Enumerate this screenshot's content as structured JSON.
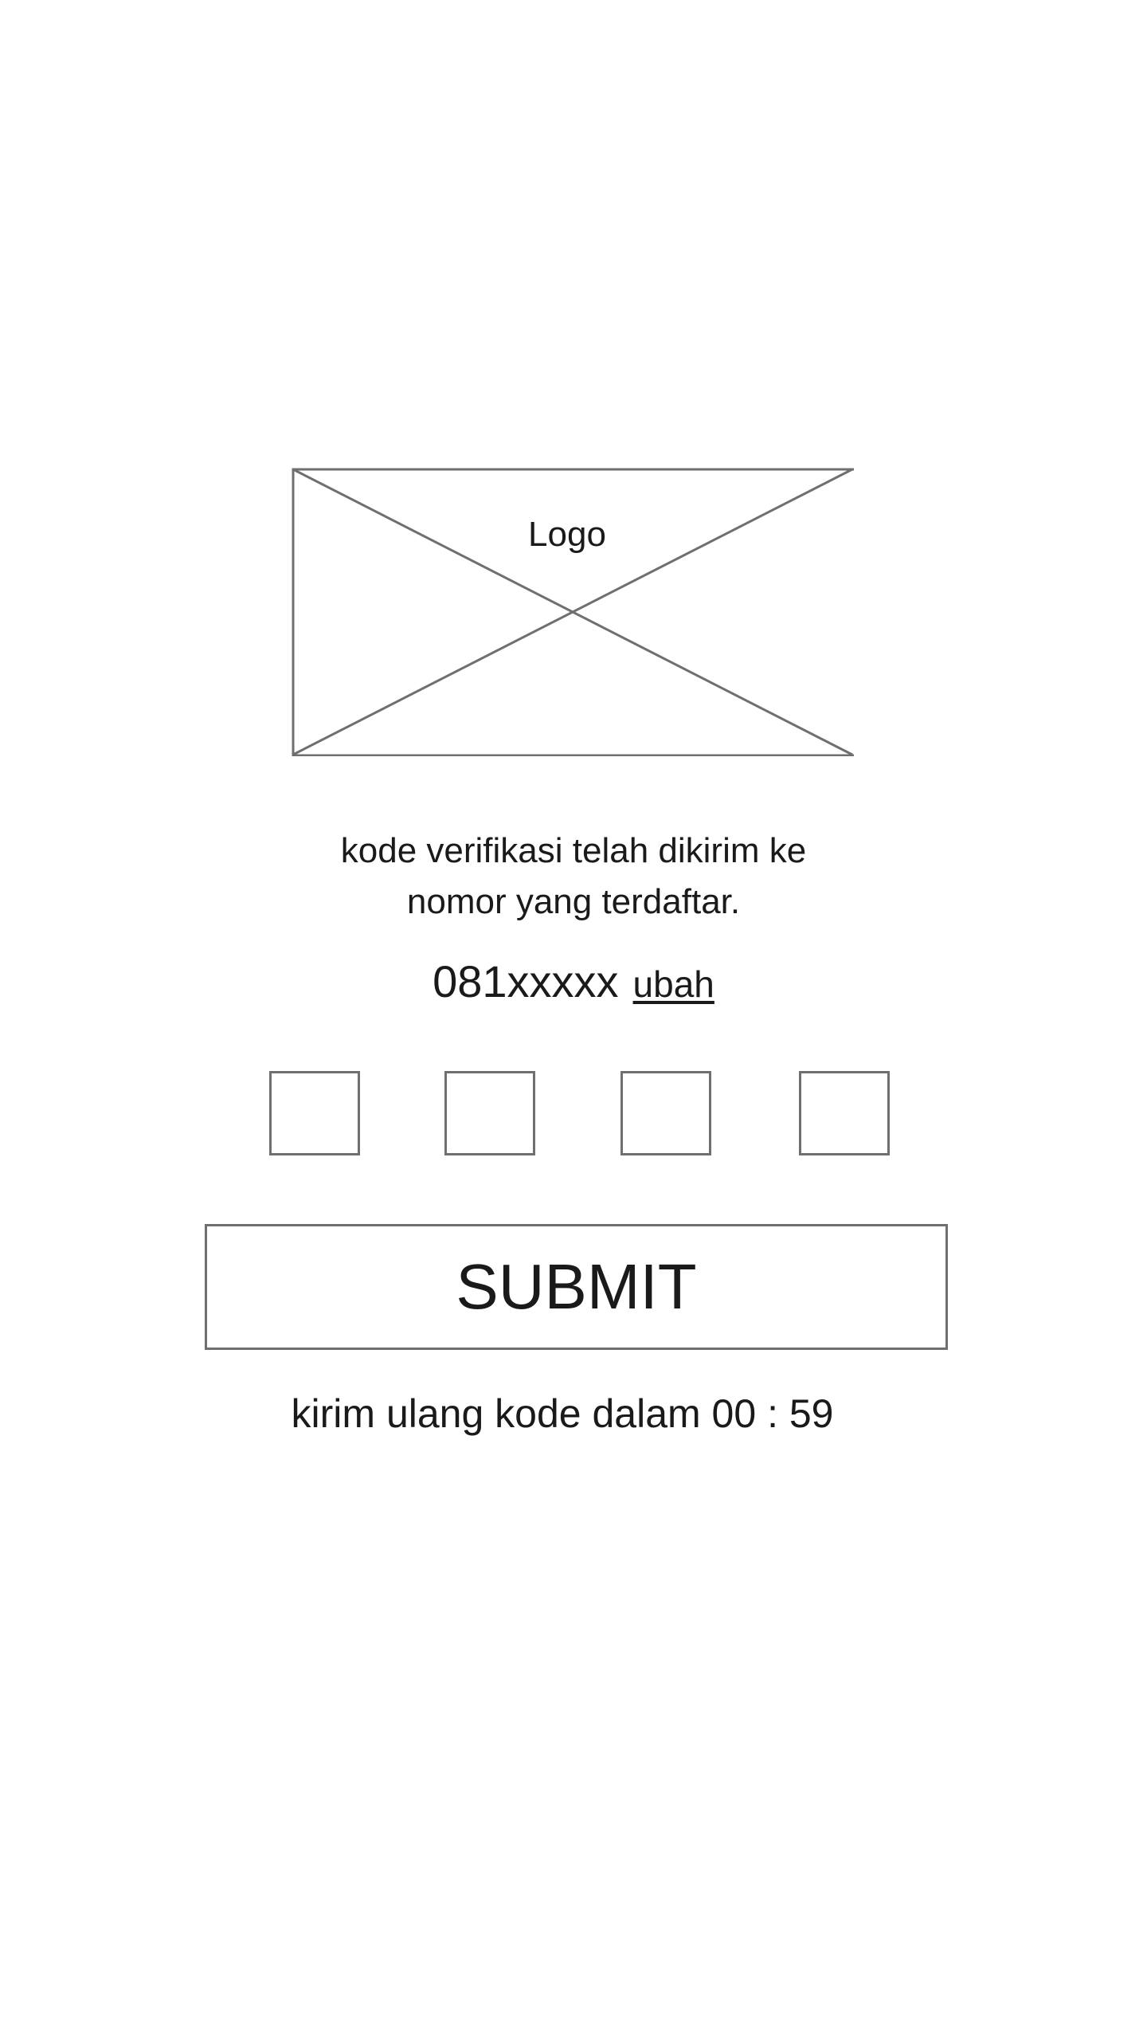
{
  "logo": {
    "label": "Logo",
    "icon": "image-placeholder-icon"
  },
  "message": {
    "line1": "kode verifikasi telah dikirim ke",
    "line2": "nomor yang terdaftar."
  },
  "phone": {
    "number": "081xxxxx",
    "change_label": "ubah"
  },
  "otp": {
    "digits": [
      "",
      "",
      "",
      ""
    ]
  },
  "submit": {
    "label": "SUBMIT"
  },
  "resend": {
    "text": "kirim ulang kode dalam 00 : 59"
  },
  "colors": {
    "border": "#6f6f6f",
    "text": "#1a1a1a",
    "background": "#ffffff"
  }
}
